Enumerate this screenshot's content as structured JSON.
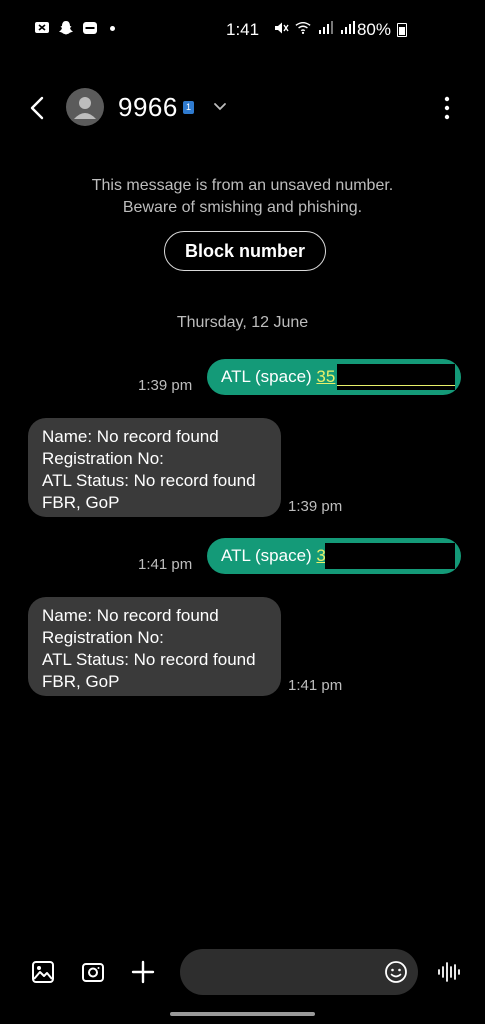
{
  "status_bar": {
    "time": "1:41",
    "battery": "80%"
  },
  "header": {
    "contact_name": "9966",
    "sim_label": "1"
  },
  "warning": {
    "line1": "This message is from an unsaved number.",
    "line2": "Beware of smishing and phishing."
  },
  "block_button": "Block number",
  "date_label": "Thursday, 12 June",
  "messages": [
    {
      "direction": "out",
      "prefix": "ATL (space) ",
      "highlight": "35",
      "time": "1:39 pm"
    },
    {
      "direction": "in",
      "lines": [
        "Name: No record found",
        "Registration No:",
        "ATL Status: No record found",
        "FBR, GoP"
      ],
      "time": "1:39 pm"
    },
    {
      "direction": "out",
      "prefix": "ATL (space) ",
      "highlight": "3",
      "time": "1:41 pm"
    },
    {
      "direction": "in",
      "lines": [
        "Name: No record found",
        "Registration No:",
        "ATL Status: No record found",
        "FBR, GoP"
      ],
      "time": "1:41 pm"
    }
  ],
  "composer": {
    "placeholder": ""
  },
  "colors": {
    "background": "#000000",
    "outgoing_bubble": "#149a78",
    "incoming_bubble": "#3a3a3a",
    "link_highlight": "#e8f06a"
  }
}
